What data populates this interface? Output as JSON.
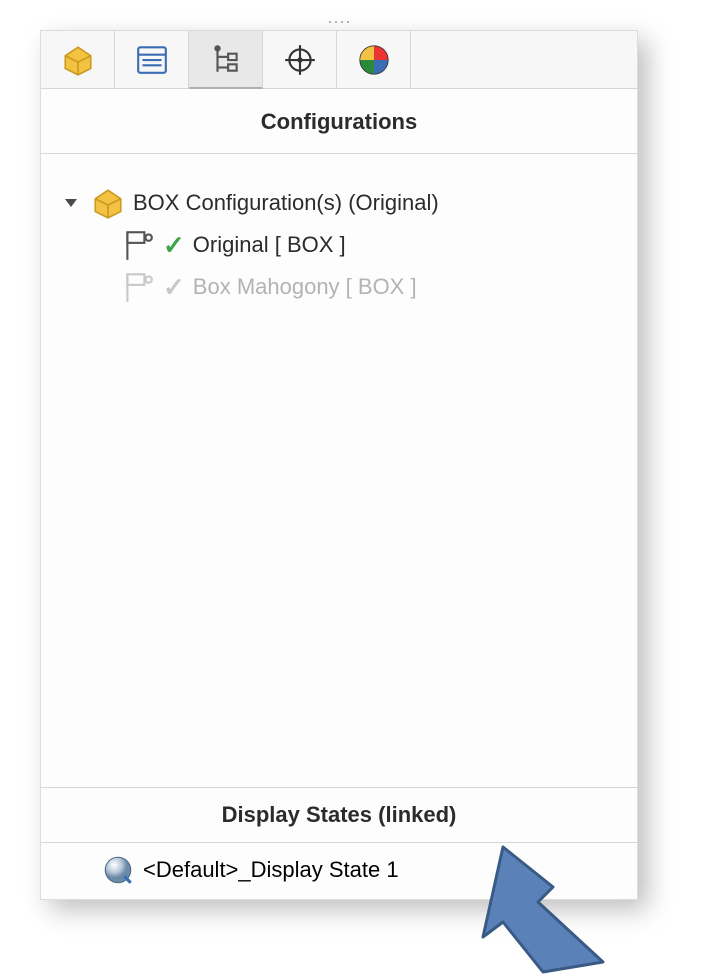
{
  "tabs": [
    {
      "name": "tab-feature",
      "icon": "block-icon"
    },
    {
      "name": "tab-properties",
      "icon": "list-icon"
    },
    {
      "name": "tab-configurations",
      "icon": "config-tree-icon",
      "active": true
    },
    {
      "name": "tab-dimxpert",
      "icon": "crosshair-icon"
    },
    {
      "name": "tab-display",
      "icon": "appearance-icon"
    }
  ],
  "section": {
    "title": "Configurations"
  },
  "tree": {
    "root_label": "BOX Configuration(s)  (Original)",
    "items": [
      {
        "label": "Original [ BOX ]",
        "active": true
      },
      {
        "label": "Box Mahogony [ BOX ]",
        "active": false
      }
    ]
  },
  "display": {
    "title": "Display States (linked)",
    "item_label": "<Default>_Display State 1"
  }
}
